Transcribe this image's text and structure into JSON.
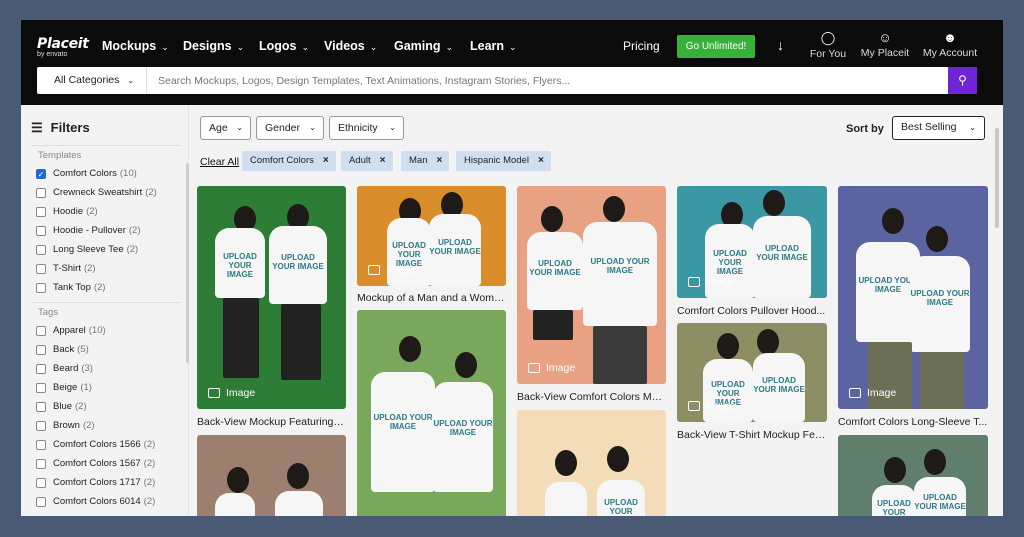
{
  "brand": {
    "name": "Placeit",
    "sub": "by envato"
  },
  "nav": [
    {
      "label": "Mockups"
    },
    {
      "label": "Designs"
    },
    {
      "label": "Logos"
    },
    {
      "label": "Videos"
    },
    {
      "label": "Gaming"
    },
    {
      "label": "Learn"
    }
  ],
  "pricing": "Pricing",
  "cta": "Go Unlimited!",
  "icons": {
    "for_you": "For You",
    "my_placeit": "My Placeit",
    "my_account": "My Account"
  },
  "search": {
    "category": "All Categories",
    "placeholder": "Search Mockups, Logos, Design Templates, Text Animations, Instagram Stories, Flyers..."
  },
  "sidebar": {
    "title": "Filters",
    "templates_label": "Templates",
    "templates": [
      {
        "label": "Comfort Colors",
        "count": "(10)",
        "checked": true
      },
      {
        "label": "Crewneck Sweatshirt",
        "count": "(2)"
      },
      {
        "label": "Hoodie",
        "count": "(2)"
      },
      {
        "label": "Hoodie - Pullover",
        "count": "(2)"
      },
      {
        "label": "Long Sleeve Tee",
        "count": "(2)"
      },
      {
        "label": "T-Shirt",
        "count": "(2)"
      },
      {
        "label": "Tank Top",
        "count": "(2)"
      }
    ],
    "tags_label": "Tags",
    "tags": [
      {
        "label": "Apparel",
        "count": "(10)"
      },
      {
        "label": "Back",
        "count": "(5)"
      },
      {
        "label": "Beard",
        "count": "(3)"
      },
      {
        "label": "Beige",
        "count": "(1)"
      },
      {
        "label": "Blue",
        "count": "(2)"
      },
      {
        "label": "Brown",
        "count": "(2)"
      },
      {
        "label": "Comfort Colors 1566",
        "count": "(2)"
      },
      {
        "label": "Comfort Colors 1567",
        "count": "(2)"
      },
      {
        "label": "Comfort Colors 1717",
        "count": "(2)"
      },
      {
        "label": "Comfort Colors 6014",
        "count": "(2)"
      }
    ]
  },
  "filters": {
    "age": "Age",
    "gender": "Gender",
    "ethnicity": "Ethnicity"
  },
  "sort": {
    "label": "Sort by",
    "value": "Best Selling"
  },
  "clear_all": "Clear All",
  "chips": [
    {
      "label": "Comfort Colors"
    },
    {
      "label": "Adult"
    },
    {
      "label": "Man"
    },
    {
      "label": "Hispanic Model"
    }
  ],
  "print_text": "UPLOAD YOUR IMAGE",
  "badge": "Image",
  "cards": [
    {
      "caption": "Back-View Mockup Featuring a..."
    },
    {
      "caption": "Mockup of a Man and a Woma..."
    },
    {
      "caption": "Back-View Comfort Colors Mo..."
    },
    {
      "caption": "Comfort Colors Pullover Hood..."
    },
    {
      "caption": "Comfort Colors Long-Sleeve T..."
    },
    {
      "caption": "Back-View T-Shirt Mockup Fea..."
    }
  ],
  "colors": {
    "accent_green": "#36b13a",
    "search_purple": "#6f24d6",
    "chip_blue": "#cfdff0"
  }
}
